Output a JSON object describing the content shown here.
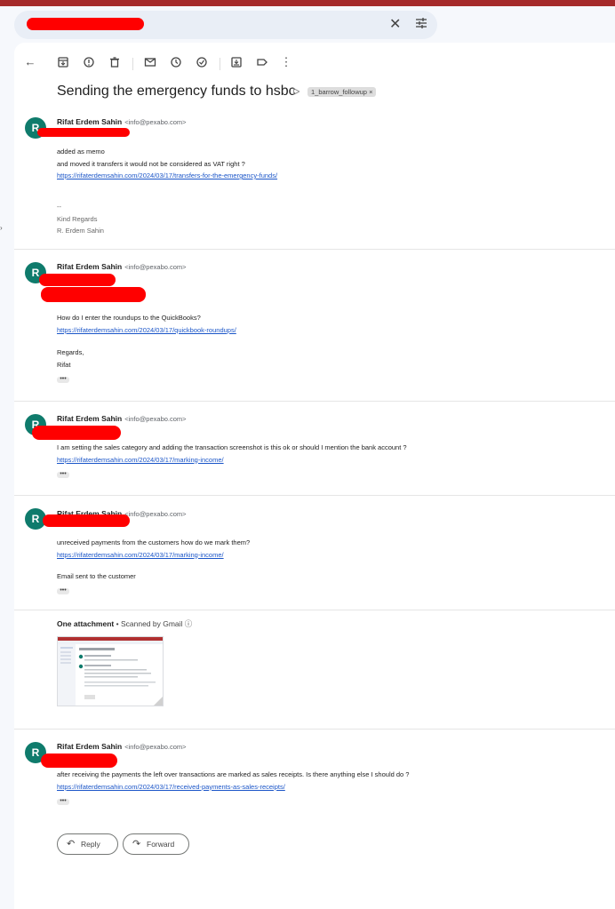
{
  "window": {
    "top_bar_color": "#a52a2a"
  },
  "search": {
    "clear_icon": "close-icon",
    "filter_icon": "tune-icon"
  },
  "toolbar": {
    "icons": [
      "back-arrow-icon",
      "archive-icon",
      "report-spam-icon",
      "delete-icon",
      "mark-unread-icon",
      "snooze-icon",
      "add-task-icon",
      "move-to-icon",
      "label-icon",
      "more-vert-icon"
    ]
  },
  "thread": {
    "subject": "Sending the emergency funds to hsbc",
    "label": "1_barrow_followup",
    "label_remove": "×"
  },
  "messages": [
    {
      "avatar": "R",
      "sender": "Rifat Erdem Sahin",
      "email": "<info@pexabo.com>",
      "lines": [
        "added as memo",
        "and moved it transfers it would not be considered as VAT right ?"
      ],
      "link": "https://rifaterdemsahin.com/2024/03/17/transfers-for-the-emergency-funds/",
      "signature": [
        "--",
        "Kind Regards",
        "R. Erdem Sahin"
      ]
    },
    {
      "avatar": "R",
      "sender": "Rifat Erdem Sahin",
      "email": "<info@pexabo.com>",
      "lines": [
        "How do I enter the roundups to the QuickBooks?"
      ],
      "link": "https://rifaterdemsahin.com/2024/03/17/quickbook-roundups/",
      "closing": [
        "Regards,",
        "Rifat"
      ],
      "more": "•••"
    },
    {
      "avatar": "R",
      "sender": "Rifat Erdem Sahin",
      "email": "<info@pexabo.com>",
      "lines": [
        "I am setting the sales category and adding the transaction screenshot is this ok or should I mention the bank account ?"
      ],
      "link": "https://rifaterdemsahin.com/2024/03/17/marking-income/",
      "more": "•••"
    },
    {
      "avatar": "R",
      "sender": "Rifat Erdem Sahin",
      "email": "<info@pexabo.com>",
      "lines": [
        "unreceived payments from the customers how do we mark them?"
      ],
      "link": "https://rifaterdemsahin.com/2024/03/17/marking-income/",
      "extra": "Email sent to the customer",
      "more": "•••",
      "attachment": {
        "title": "One attachment",
        "scanned": "• Scanned by Gmail",
        "info_icon": "info-icon"
      }
    },
    {
      "avatar": "R",
      "sender": "Rifat Erdem Sahin",
      "email": "<info@pexabo.com>",
      "lines": [
        "after receiving the payments the left over transactions are marked as sales receipts. Is there anything else I should do ?"
      ],
      "link": "https://rifaterdemsahin.com/2024/03/17/received-payments-as-sales-receipts/",
      "more": "•••"
    }
  ],
  "actions": {
    "reply": "Reply",
    "forward": "Forward"
  },
  "colors": {
    "avatar": "#0f7b6c",
    "link": "#1a55c8",
    "redaction": "#ff0000"
  }
}
